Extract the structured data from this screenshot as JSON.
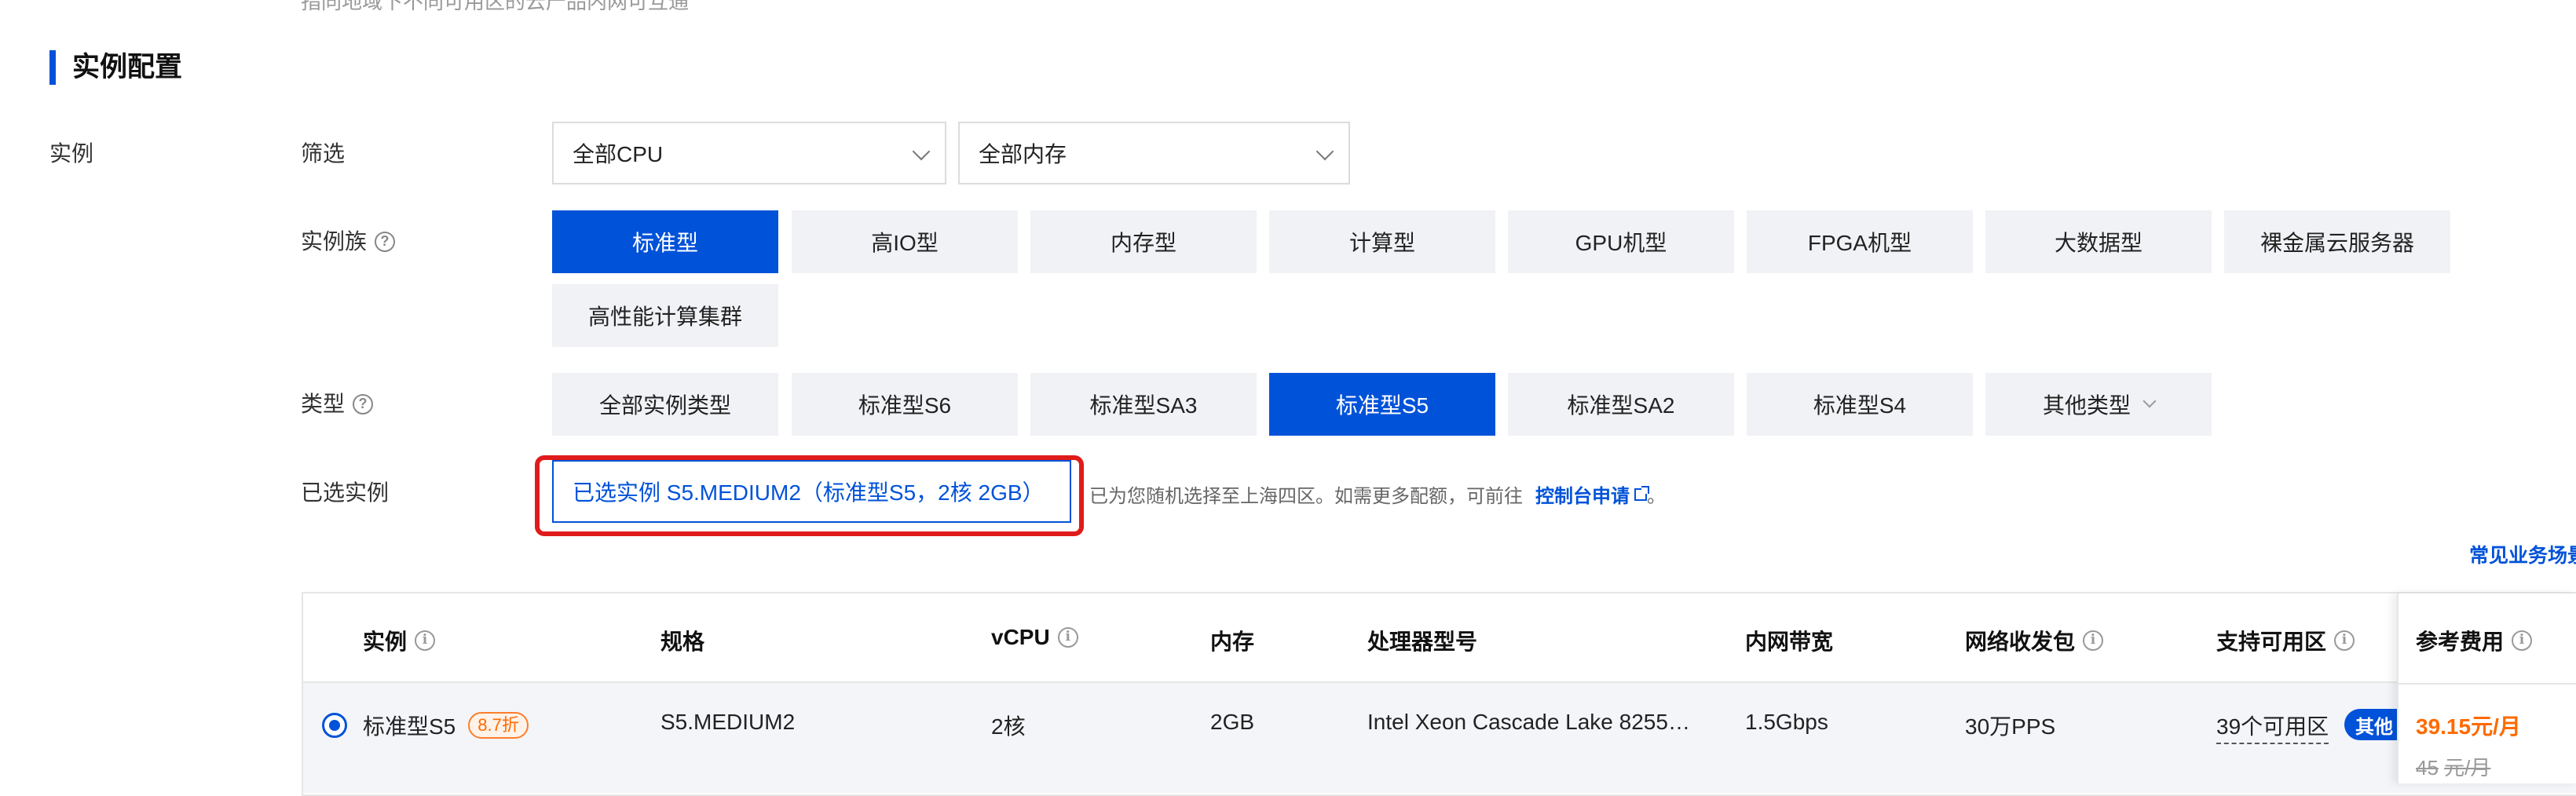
{
  "top_cut_text": "指同地域下不同可用区的云产品内网可互通",
  "section": {
    "title": "实例配置"
  },
  "instance": {
    "label": "实例",
    "filter": {
      "label": "筛选",
      "cpu_select": "全部CPU",
      "memory_select": "全部内存"
    },
    "family": {
      "label": "实例族",
      "options": [
        "标准型",
        "高IO型",
        "内存型",
        "计算型",
        "GPU机型",
        "FPGA机型",
        "大数据型",
        "裸金属云服务器",
        "高性能计算集群"
      ],
      "selected": "标准型"
    },
    "type": {
      "label": "类型",
      "options": [
        "全部实例类型",
        "标准型S6",
        "标准型SA3",
        "标准型S5",
        "标准型SA2",
        "标准型S4",
        "其他类型"
      ],
      "selected": "标准型S5"
    },
    "selected_instance": {
      "label": "已选实例",
      "value": "已选实例 S5.MEDIUM2（标准型S5，2核 2GB）",
      "hint": "已为您随机选择至上海四区。如需更多配额，可前往",
      "link": "控制台申请",
      "hint_end": "。"
    }
  },
  "common_scenarios_link": "常见业务场景",
  "table": {
    "headers": {
      "instance": "实例",
      "spec": "规格",
      "vcpu": "vCPU",
      "memory": "内存",
      "processor": "处理器型号",
      "bandwidth": "内网带宽",
      "pps": "网络收发包",
      "zones": "支持可用区",
      "fee": "参考费用"
    },
    "rows": [
      {
        "instance": "标准型S5",
        "discount": "8.7折",
        "spec": "S5.MEDIUM2",
        "vcpu": "2核",
        "memory": "2GB",
        "processor": "Intel Xeon Cascade Lake 8255…",
        "bandwidth": "1.5Gbps",
        "pps": "30万PPS",
        "zones": "39个可用区",
        "zone_badge": "其他",
        "price": "39.15元/月",
        "original_price": "45",
        "original_unit": "元/月"
      }
    ]
  }
}
